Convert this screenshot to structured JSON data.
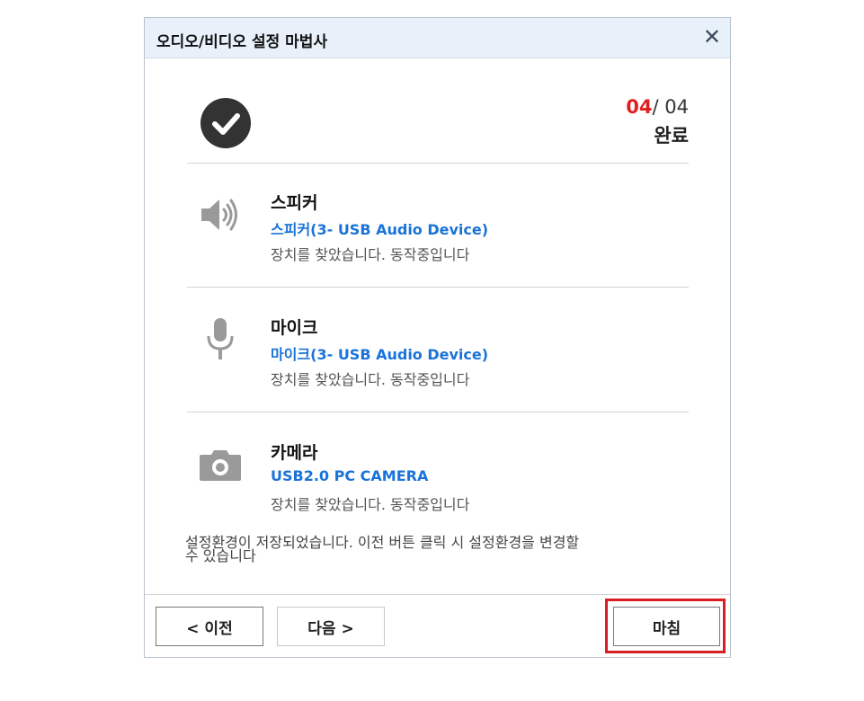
{
  "dialog": {
    "title": "오디오/비디오 설정 마법사",
    "close_glyph": "✕"
  },
  "progress": {
    "current": "04",
    "total": "/ 04",
    "status": "완료"
  },
  "devices": [
    {
      "icon": "speaker-icon",
      "name": "스피커",
      "model": "스피커(3- USB Audio Device)",
      "state": "장치를 찾았습니다. 동작중입니다"
    },
    {
      "icon": "microphone-icon",
      "name": "마이크",
      "model": "마이크(3- USB Audio Device)",
      "state": "장치를 찾았습니다. 동작중입니다"
    },
    {
      "icon": "camera-icon",
      "name": "카메라",
      "model": "USB2.0 PC CAMERA",
      "state": "장치를 찾았습니다. 동작중입니다"
    }
  ],
  "note": {
    "line1": "설정환경이 저장되었습니다. 이전 버튼 클릭 시 설정환경을 변경할",
    "line2": "수 있습니다"
  },
  "buttons": {
    "prev": "< 이전",
    "next": "다음 >",
    "finish": "마침"
  },
  "colors": {
    "accent_blue": "#1a73d8",
    "step_red": "#e02020",
    "highlight_red": "#d81f26",
    "titlebar": "#e8f1fa"
  }
}
